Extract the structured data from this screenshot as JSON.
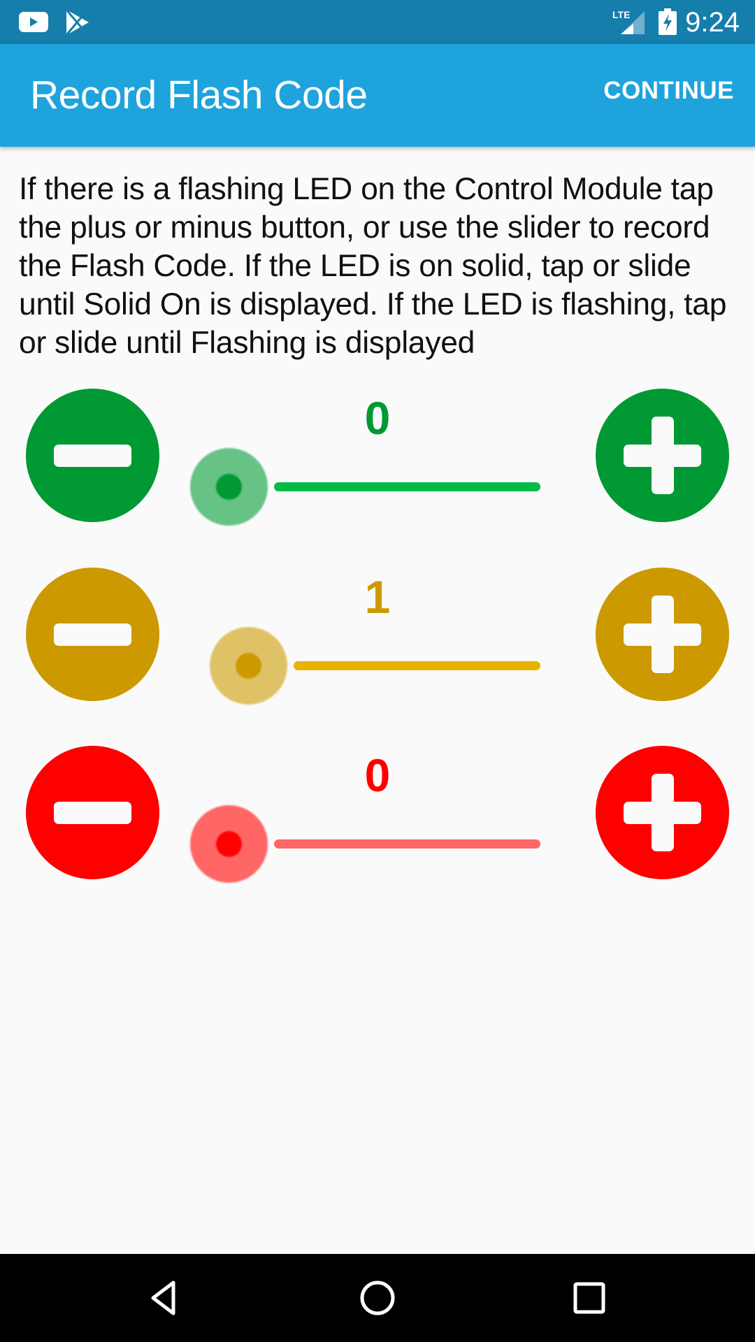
{
  "status_bar": {
    "time": "9:24",
    "left_icons": [
      "youtube-icon",
      "play-store-icon"
    ],
    "right_icons": [
      "lte-signal-icon",
      "battery-charging-icon"
    ],
    "network_label": "LTE"
  },
  "app_bar": {
    "title": "Record Flash Code",
    "action_label": "CONTINUE"
  },
  "instructions": "If there is a flashing LED on the Control Module tap the plus or minus button, or use the slider to record the Flash Code. If the LED is on solid, tap or slide until Solid On is displayed. If the LED is flashing, tap or slide until Flashing is displayed",
  "counters": [
    {
      "name": "green",
      "value": "0",
      "slider_fraction": 0.0,
      "colors": {
        "button": "#009933",
        "label": "#009933",
        "track": "#00bb44",
        "thumb_halo": "#66c285",
        "thumb_dot": "#009933"
      },
      "minus_icon": "minus-icon",
      "plus_icon": "plus-icon"
    },
    {
      "name": "yellow",
      "value": "1",
      "slider_fraction": 0.07,
      "colors": {
        "button": "#cc9900",
        "label": "#cc9900",
        "track": "#e8b300",
        "thumb_halo": "#e0c266",
        "thumb_dot": "#cc9900"
      },
      "minus_icon": "minus-icon",
      "plus_icon": "plus-icon"
    },
    {
      "name": "red",
      "value": "0",
      "slider_fraction": 0.0,
      "colors": {
        "button": "#ff0000",
        "label": "#ff0000",
        "track": "#ff6666",
        "thumb_halo": "#ff6666",
        "thumb_dot": "#ff0000"
      },
      "minus_icon": "minus-icon",
      "plus_icon": "plus-icon"
    }
  ],
  "nav_bar": {
    "buttons": [
      "back-icon",
      "home-icon",
      "recents-icon"
    ]
  }
}
